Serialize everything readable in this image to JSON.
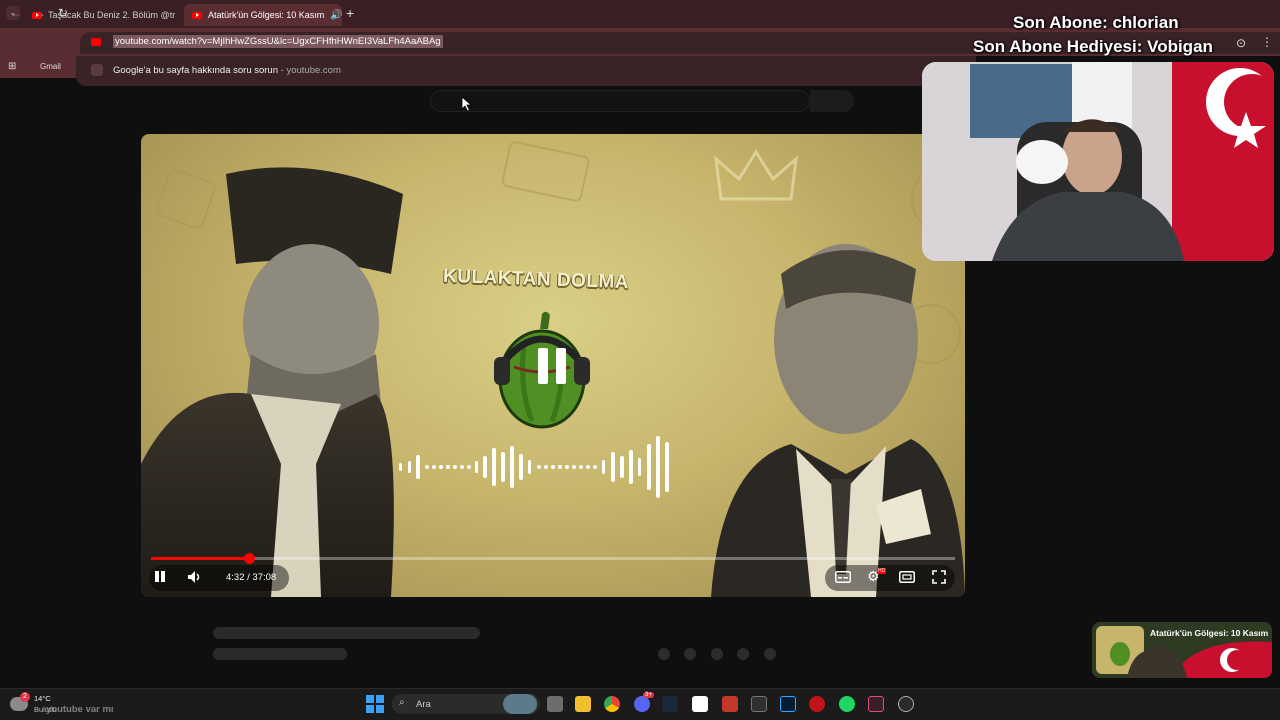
{
  "browser": {
    "tabs": [
      {
        "label": "Taşacak Bu Deniz 2. Bölüm @tr",
        "active": false
      },
      {
        "label": "Atatürk'ün Gölgesi: 10 Kasım",
        "active": true
      }
    ],
    "new_tab_label": "+",
    "url": "youtube.com/watch?v=MjIhHwZGssU&lc=UgxCFHfhHWnEI3VaLFh4AaABAg",
    "suggestion": {
      "text": "Google'a bu sayfa hakkında soru sorun",
      "source": "youtube.com"
    },
    "bookmark_label": "Gmail"
  },
  "player": {
    "channel_brand": "KULAKTAN DOLMA",
    "time_display": "4:32 / 37:08",
    "progress_fraction": 0.122,
    "hd_badge": "HD",
    "state": "playing"
  },
  "stream_overlay": {
    "last_subscriber": "Son Abone: chlorian",
    "last_gift": "Son Abone Hediyesi: Vobigan",
    "now_playing": "Atatürk'ün Gölgesi: 10 Kasım"
  },
  "taskbar": {
    "search_placeholder": "Ara",
    "weather_temp": "14°C",
    "weather_desc": "Bulutlu",
    "notification_count": "2",
    "ticker_text": "youtube var mı",
    "discord_badge": "3+"
  },
  "colors": {
    "accent": "#ff0000",
    "tab_bar": "#3a1f24",
    "toolbar": "#5a2d33",
    "page_bg": "#0f0f0f"
  }
}
